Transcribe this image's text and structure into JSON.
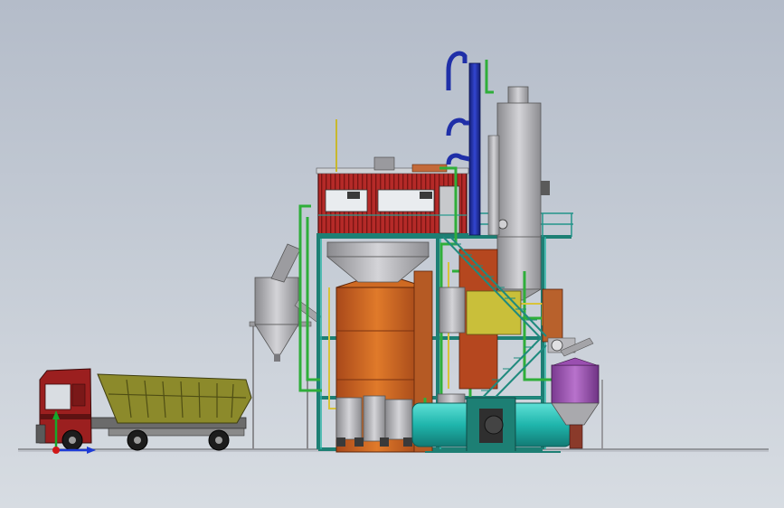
{
  "viewport": {
    "background_top": "#b4bcc9",
    "background_bottom": "#d7dce2"
  },
  "colors": {
    "structure_teal": "#2a9c8f",
    "tank_orange": "#d2681f",
    "cabin_red": "#b22a2a",
    "truck_red": "#9b1f1f",
    "truck_bed_olive": "#8c8a2b",
    "column_blue": "#1f2fa8",
    "pipe_green": "#2fae3a",
    "pipe_yellow": "#d8c33a",
    "steel_grey": "#a8a8ac",
    "hopper_purple": "#9a4fb0",
    "dryer_teal": "#21b8b0",
    "axis_x": "#1e3bd6",
    "axis_y": "#16a82a",
    "axis_origin": "#d01818"
  },
  "scene": {
    "objects": [
      "dump-truck",
      "feed-hopper",
      "inclined-conveyor",
      "main-steel-structure",
      "control-room",
      "digester-tank",
      "distillation-column",
      "evaporator-vessel",
      "small-process-tanks",
      "rotary-dryer",
      "purple-hopper",
      "stair-tower"
    ]
  },
  "triad": {
    "icon": "coordinate-triad-icon"
  }
}
